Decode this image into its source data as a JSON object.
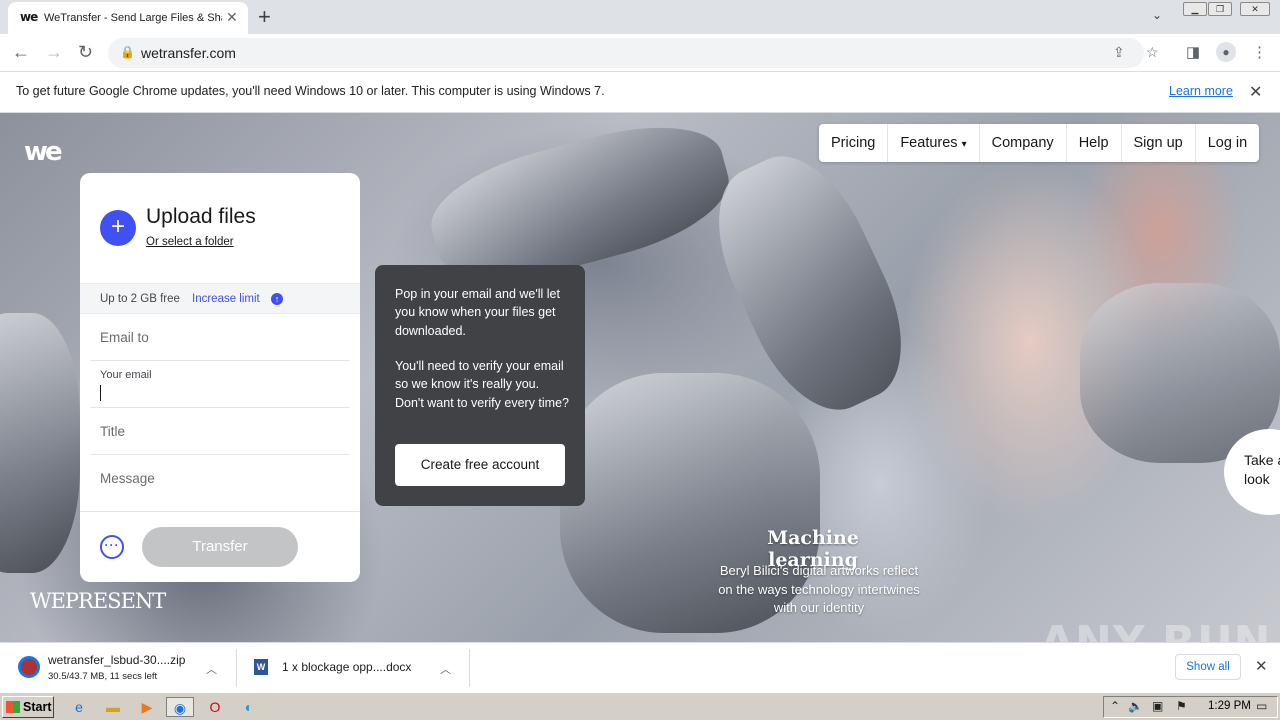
{
  "browser": {
    "tab_title": "WeTransfer - Send Large Files & Sha",
    "tab_favicon": "we",
    "url": "wetransfer.com"
  },
  "infobar": {
    "message": "To get future Google Chrome updates, you'll need Windows 10 or later. This computer is using Windows 7.",
    "learn_more": "Learn more"
  },
  "site": {
    "logo": "we",
    "nav": [
      "Pricing",
      "Features",
      "Company",
      "Help",
      "Sign up",
      "Log in"
    ],
    "upload": {
      "title": "Upload files",
      "folder_link": "Or select a folder",
      "limit_text": "Up to 2 GB free",
      "increase_limit": "Increase limit",
      "email_to": "Email to",
      "your_email_label": "Your email",
      "title_placeholder": "Title",
      "message_placeholder": "Message",
      "transfer_button": "Transfer"
    },
    "tooltip": {
      "paragraph1": "Pop in your email and we'll let you know when your files get downloaded.",
      "paragraph2": "You'll need to verify your email so we know it's really you. Don't want to verify every time?",
      "button": "Create free account"
    },
    "ad": {
      "title": "Machine learning",
      "description": "Beryl Bilici's digital artworks reflect on the ways technology intertwines with our identity"
    },
    "wepresent": "WEPRESENT",
    "take_look": "Take a look"
  },
  "downloads": [
    {
      "name": "wetransfer_lsbud-30....zip",
      "status": "30.5/43.7 MB, 11 secs left"
    },
    {
      "name": "1 x blockage opp....docx",
      "status": ""
    }
  ],
  "downloads_show_all": "Show all",
  "watermark": "ANY RUN",
  "taskbar": {
    "start": "Start",
    "clock": "1:29 PM"
  }
}
